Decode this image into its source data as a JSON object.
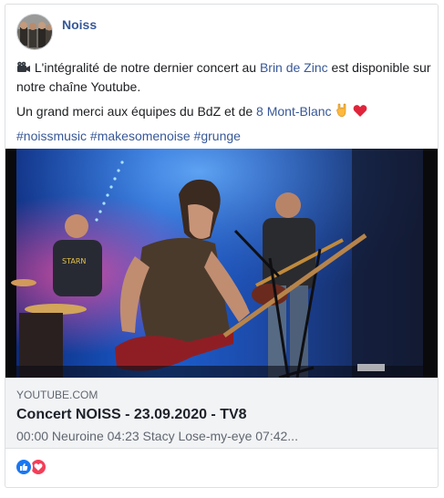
{
  "post": {
    "author": "Noiss",
    "text": {
      "intro": "L'intégralité de notre dernier concert au",
      "link_venue": "Brin de Zinc",
      "after_venue": "est disponible sur notre chaîne Youtube.",
      "thanks": "Un grand merci aux équipes du BdZ et de",
      "link_tv": "8 Mont-Blanc",
      "hashtags": [
        "#noissmusic",
        "#makesomenoise",
        "#grunge"
      ]
    },
    "icons": {
      "camera": "movie-camera-icon",
      "horns": "rock-hand-icon",
      "heart": "red-heart-icon",
      "like": "like-reaction-icon",
      "love": "love-reaction-icon"
    },
    "colors": {
      "link": "#385898",
      "author": "#365899",
      "like": "#1877f2",
      "love": "#f33e58",
      "preview_bg": "#f2f3f5"
    }
  },
  "link_preview": {
    "domain": "YOUTUBE.COM",
    "title": "Concert NOISS - 23.09.2020 - TV8",
    "description": "00:00 Neuroine 04:23 Stacy Lose-my-eye 07:42..."
  }
}
